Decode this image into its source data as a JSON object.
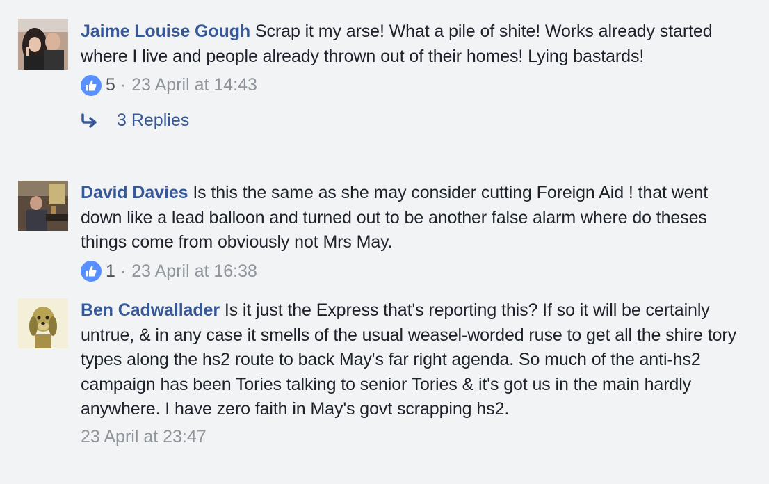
{
  "comments": [
    {
      "author": "Jaime Louise Gough",
      "text": "Scrap it my arse! What a pile of shite! Works already started where I live and people already thrown out of their homes! Lying bastards!",
      "likes": "5",
      "separator": "·",
      "timestamp": "23 April at 14:43",
      "replies": "3 Replies",
      "avatar_icon": "profile-photo-couple"
    },
    {
      "author": "David Davies",
      "text": "Is this the same as she may consider cutting Foreign Aid ! that went down like a lead balloon and turned out to be another false alarm where do theses things come from obviously not Mrs May.",
      "likes": "1",
      "separator": "·",
      "timestamp": "23 April at 16:38",
      "avatar_icon": "profile-photo-pub"
    },
    {
      "author": "Ben Cadwallader",
      "text": "Is it just the Express that's reporting this? If so it will be certainly untrue, & in any case it smells of the usual weasel-worded ruse to get all the shire tory types along the hs2 route to back May's far right agenda. So much of the anti-hs2 campaign has been Tories talking to senior Tories & it's got us in the main hardly anywhere. I have zero faith in May's govt scrapping hs2.",
      "timestamp": "23 April at 23:47",
      "avatar_icon": "profile-photo-cartoon-dog"
    }
  ],
  "colors": {
    "background": "#f2f3f5",
    "author": "#365899",
    "meta": "#90949c",
    "like_badge": "#5890ff",
    "link": "#365899"
  },
  "icons": {
    "like": "thumbs-up-icon",
    "reply": "reply-arrow-icon"
  }
}
